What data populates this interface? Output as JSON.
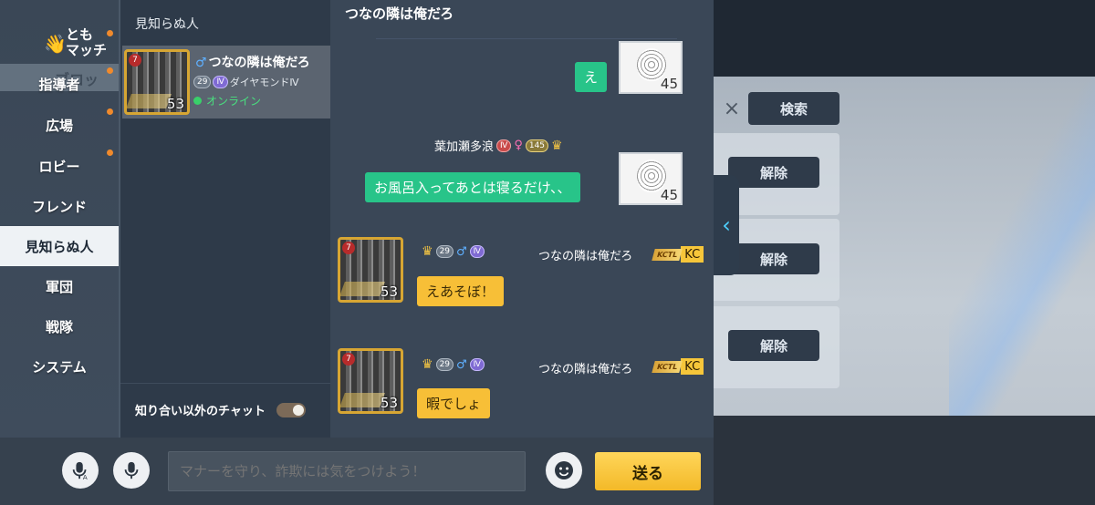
{
  "nav": {
    "tomo_line1": "とも",
    "tomo_line2": "マッチ",
    "items": [
      {
        "label": "指導者",
        "dot": true
      },
      {
        "label": "広場",
        "dot": true
      },
      {
        "label": "ロビー",
        "dot": true
      },
      {
        "label": "フレンド",
        "dot": false
      },
      {
        "label": "見知らぬ人",
        "dot": false,
        "active": true
      },
      {
        "label": "軍団",
        "dot": false
      },
      {
        "label": "戦隊",
        "dot": false
      },
      {
        "label": "システム",
        "dot": false
      }
    ]
  },
  "friend_list": {
    "title": "見知らぬ人",
    "entries": [
      {
        "gender_icon": "♂",
        "name": "つなの隣は俺だろ",
        "badge1": "29",
        "badge2": "Ⅳ",
        "rank": "ダイヤモンドⅣ",
        "status": "オンライン",
        "level": "53",
        "rank_num": "7"
      }
    ],
    "toggle_label": "知り合い以外のチャット",
    "toggle_on": true
  },
  "chat": {
    "title": "つなの隣は俺だろ",
    "messages": [
      {
        "text": "え",
        "level": "45"
      },
      {
        "sender": "葉加瀬多浪",
        "badge_v": "Ⅳ",
        "gender": "♀",
        "badge_num": "145",
        "text": "お風呂入ってあとは寝るだけ、、",
        "level": "45"
      },
      {
        "sender": "つなの隣は俺だろ",
        "badge_num": "29",
        "gender": "♂",
        "badge_v": "Ⅳ",
        "kc_tag": "KCTL",
        "kc": "KC",
        "text": "えあそぼ！",
        "level": "53",
        "rank_num": "7"
      },
      {
        "sender": "つなの隣は俺だろ",
        "badge_num": "29",
        "gender": "♂",
        "badge_v": "Ⅳ",
        "kc_tag": "KCTL",
        "kc": "KC",
        "text": "暇でしょ",
        "level": "53",
        "rank_num": "7"
      }
    ]
  },
  "bottom": {
    "input_placeholder": "マナーを守り、詐欺には気をつけよう！",
    "send_label": "送る"
  },
  "background": {
    "search_clear": "×",
    "search_label": "検索",
    "unlock_labels": [
      "解除",
      "解除",
      "解除"
    ],
    "partial_text": "ブロッ"
  },
  "icons": {
    "collapse": "chevron-left-icon",
    "mic_translate": "mic-translate-icon",
    "mic": "mic-icon",
    "emoji": "smile-icon"
  },
  "colors": {
    "accent_green": "#28c489",
    "accent_yellow": "#f7bf37",
    "online_green": "#39d06a",
    "notify_dot": "#f08a2c"
  }
}
